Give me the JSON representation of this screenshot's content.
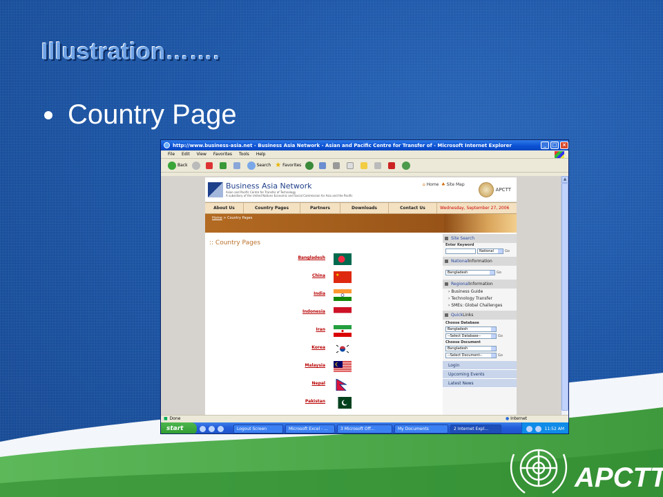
{
  "slide": {
    "title": "Illustration…….",
    "bullet": "Country Page",
    "logo_text": "APCTT",
    "colors": {
      "background": "#1d56a6",
      "title": "#6fa3e6",
      "swoosh_green": "#4aa84a"
    }
  },
  "browser": {
    "window_title": "http://www.business-asia.net - Business Asia Network - Asian and Pacific Centre for Transfer of - Microsoft Internet Explorer",
    "menu": [
      "File",
      "Edit",
      "View",
      "Favorites",
      "Tools",
      "Help"
    ],
    "toolbar": {
      "back": "Back",
      "search": "Search",
      "favorites": "Favorites"
    },
    "status": "Done",
    "zone": "Internet"
  },
  "site": {
    "name": "Business Asia Network",
    "tagline1": "Asian and Pacific Centre for Transfer of Technology",
    "tagline2": "A subsidiary of the United Nations Economic and Social Commission for Asia and the Pacific",
    "home": "Home",
    "sitemap": "Site Map",
    "org": "APCTT",
    "nav": [
      "About Us",
      "Country Pages",
      "Partners",
      "Downloads",
      "Contact Us"
    ],
    "date": "Wednesday, September 27, 2006",
    "breadcrumb_home": "Home",
    "breadcrumb_rest": " > Country Pages",
    "page_title": ":: Country Pages",
    "countries": [
      "Bangladesh",
      "China",
      "India",
      "Indonesia",
      "Iran",
      "Korea",
      "Malaysia",
      "Nepal",
      "Pakistan"
    ]
  },
  "sidebar": {
    "site_search": "Site Search",
    "enter_keyword": "Enter Keyword",
    "national_select": "National",
    "national_info_a": "National",
    "national_info_b": " Information",
    "national_country": "Bangladesh",
    "regional_info_a": "Regional",
    "regional_info_b": " Information",
    "regional_items": [
      "Business Guide",
      "Technology Transfer",
      "SMEs: Global Challenges"
    ],
    "quick_links_a": "Quick",
    "quick_links_b": " Links",
    "choose_database": "Choose Database",
    "db_country": "Bangladesh",
    "db_select": "--Select Database--",
    "choose_document": "Choose Document",
    "doc_country": "Bangladesh",
    "doc_select": "--Select Document--",
    "links": [
      "Login",
      "Upcoming Events",
      "Latest News"
    ]
  },
  "taskbar": {
    "start": "start",
    "tasks": [
      "Logout Screen",
      "Microsoft Excel - ...",
      "3 Microsoft Off...",
      "My Documents",
      "2 Internet Expl..."
    ],
    "clock": "11:52 AM"
  }
}
